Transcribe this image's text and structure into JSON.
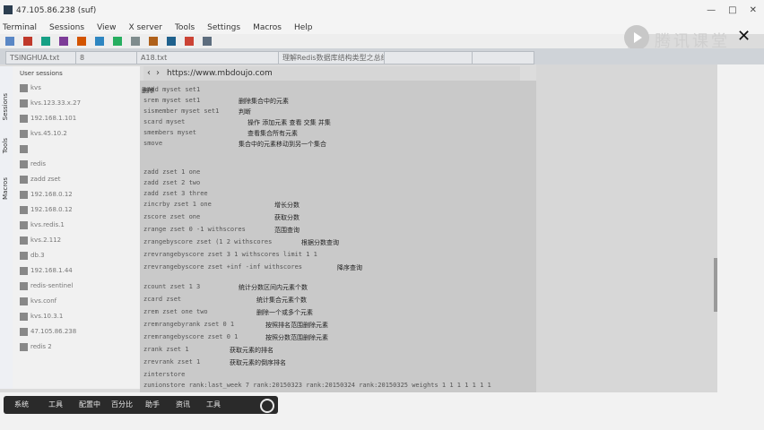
{
  "window": {
    "title": "47.105.86.238 (suf)"
  },
  "window_controls": {
    "minimize": "—",
    "maximize": "□",
    "close": "✕"
  },
  "menu": [
    "Terminal",
    "Sessions",
    "View",
    "X server",
    "Tools",
    "Settings",
    "Macros",
    "Help"
  ],
  "watermark": {
    "text": "腾讯课堂"
  },
  "tabs": [
    "TSINGHUA.txt",
    "8",
    "A18.txt",
    "理解Redis数据库结构类型之总结",
    "",
    ""
  ],
  "address": {
    "back": "‹",
    "forward": "›",
    "url": "https://www.mbdoujo.com"
  },
  "sidebar_labels": {
    "sessions": "Sessions",
    "tools": "Tools",
    "macros": "Macros"
  },
  "sessions_header": "User sessions",
  "sidebar_items": [
    "kvs",
    "kvs.123.33.x.27",
    "192.168.1.101",
    "kvs.45.10.2",
    "",
    "redis",
    "zadd zset",
    "192.168.0.12",
    "192.168.0.12",
    "kvs.redis.1",
    "kvs.2.112",
    "db.3",
    "192.168.1.44",
    "redis-sentinel",
    "kvs.conf",
    "kvs.10.3.1",
    "47.105.86.238",
    "redis 2"
  ],
  "terminal_lines": [
    {
      "cmd": "sadd myset set1",
      "note": "删除"
    },
    {
      "cmd": "srem myset set1",
      "note": "删除集合中的元素"
    },
    {
      "cmd": "sismember myset set1",
      "note": "判断"
    },
    {
      "cmd": "scard myset",
      "note": "操作    添加元素    查看    交集    并集"
    },
    {
      "cmd": "smembers myset",
      "note": "查看集合所有元素"
    },
    {
      "cmd": "smove",
      "note": "集合中的元素移动到另一个集合"
    },
    {
      "cmd": "",
      "note": ""
    },
    {
      "cmd": "zadd zset 1 one",
      "note": ""
    },
    {
      "cmd": "zadd zset 2 two",
      "note": ""
    },
    {
      "cmd": "zadd zset 3 three",
      "note": ""
    },
    {
      "cmd": "zincrby zset 1 one",
      "note": "增长分数"
    },
    {
      "cmd": "zscore zset one",
      "note": "获取分数"
    },
    {
      "cmd": "zrange zset 0 -1 withscores",
      "note": "范围查询"
    },
    {
      "cmd": "zrangebyscore zset (1 2 withscores",
      "note": "根据分数查询"
    },
    {
      "cmd": "zrevrangebyscore zset 3 1 withscores limit 1 1",
      "note": ""
    },
    {
      "cmd": "zrevrangebyscore zset +inf -inf withscores",
      "note": "降序查询"
    },
    {
      "cmd": "zcount zset 1 3",
      "note": "统计分数区间内元素个数"
    },
    {
      "cmd": "zcard zset",
      "note": "统计集合元素个数"
    },
    {
      "cmd": "zrem zset one two",
      "note": "删除一个或多个元素"
    },
    {
      "cmd": "zremrangebyrank zset 0 1",
      "note": "按照排名范围删除元素"
    },
    {
      "cmd": "zremrangebyscore zset 0 1",
      "note": "按照分数范围删除元素"
    },
    {
      "cmd": "zrank zset 1",
      "note": "获取元素的排名"
    },
    {
      "cmd": "zrevrank zset 1",
      "note": "获取元素的倒序排名"
    },
    {
      "cmd": "zinterstore",
      "note": ""
    },
    {
      "cmd": "zunionstore rank:last_week 7 rank:20150323 rank:20150324 rank:20150325 weights 1 1 1 1 1 1 1",
      "note": ""
    }
  ],
  "dock": [
    "系统",
    "工具",
    "配置中",
    "百分比",
    "助手",
    "资讯",
    "工具"
  ]
}
